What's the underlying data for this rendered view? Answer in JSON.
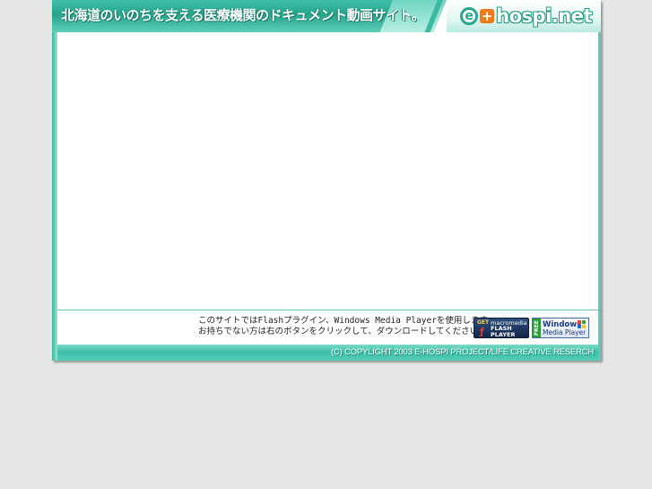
{
  "header": {
    "tagline": "北海道のいのちを支える医療機関のドキュメント動画サイト。",
    "logo_e": "e",
    "logo_plus": "+",
    "logo_text": "hospi.net"
  },
  "notice": {
    "line1": "このサイトではFlashプラグイン、Windows Media Playerを使用します。",
    "line2": "お持ちでない方は右のボタンをクリックして、ダウンロードしてください。"
  },
  "badges": {
    "flash": {
      "get": "GET",
      "brand": "macromedia",
      "line1": "FLASH",
      "line2": "PLAYER"
    },
    "wmp": {
      "free": "FREE",
      "line1": "Windows",
      "line2": "Media Player"
    }
  },
  "footer": {
    "copyright": "(C) COPYLIGHT 2003 E-HOSPI PROJECT/LIFE CREATIVE RESERCH"
  },
  "colors": {
    "accent": "#25a48c",
    "page_background": "#e6e6e6",
    "logo_plus": "#f07a1a"
  }
}
